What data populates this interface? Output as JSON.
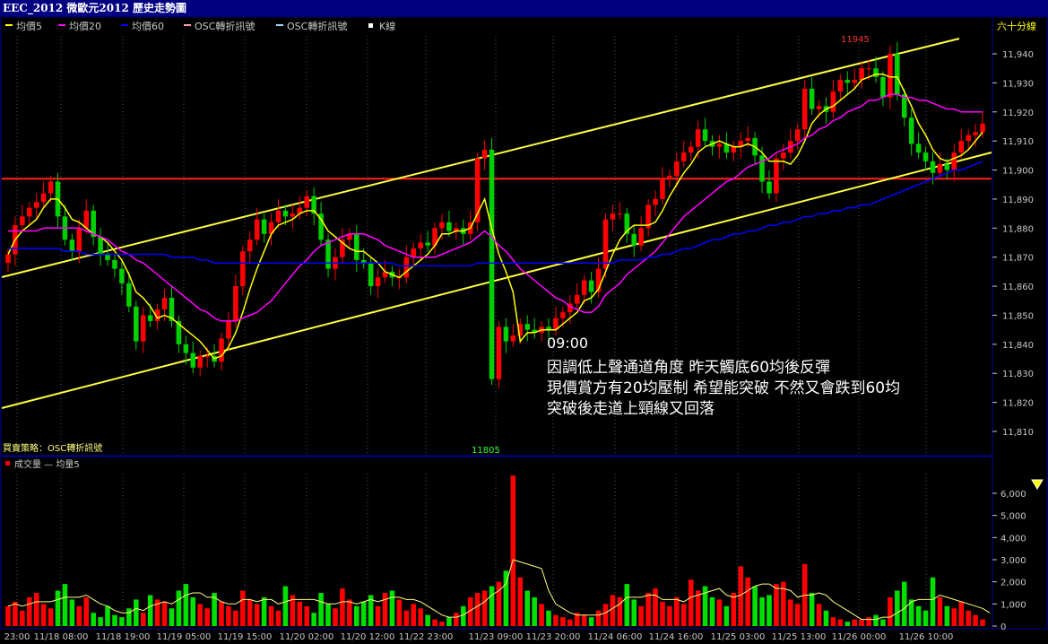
{
  "window": {
    "title": "EEC_2012 微歐元2012  歷史走勢圖"
  },
  "legend": [
    {
      "label": "均價5",
      "color": "#ffff00"
    },
    {
      "label": "均價20",
      "color": "#ff00ff"
    },
    {
      "label": "均價60",
      "color": "#0000ff"
    },
    {
      "label": "OSC轉折訊號",
      "color": "#ff9fc0"
    },
    {
      "label": "OSC轉折訊號",
      "color": "#9fd8ff"
    },
    {
      "label": "K線",
      "color": "#ffffff"
    }
  ],
  "period_label": "六十分線",
  "strategy_label": "買賣策略：OSC轉折訊號",
  "volume_legend": "成交量 — 均量5",
  "annotation": {
    "time": "09:00",
    "lines": [
      "因調低上聲通道角度 昨天觸底60均後反彈",
      "現價賞方有20均壓制 希望能突破 不然又會跌到60均",
      "突破後走道上頸線又回落"
    ]
  },
  "chart_data": [
    {
      "type": "candlestick",
      "title": "EEC_2012 微歐元2012 歷史走勢圖",
      "period": "六十分線",
      "y_range": [
        11805,
        11948
      ],
      "y_ticks": [
        "11,940",
        "11,930",
        "11,920",
        "11,910",
        "11,900",
        "11,890",
        "11,880",
        "11,870",
        "11,860",
        "11,850",
        "11,840",
        "11,830",
        "11,820",
        "11,810"
      ],
      "x_ticks": [
        "23:00",
        "11/18 08:00",
        "11/18 19:00",
        "11/19 05:00",
        "11/19 15:00",
        "11/20 02:00",
        "11/20 12:00",
        "11/22 23:00",
        "11/23 09:00",
        "11/23 20:00",
        "11/24 06:00",
        "11/24 16:00",
        "11/25 03:00",
        "11/25 13:00",
        "11/26 00:00",
        "11/26 10:00"
      ],
      "high_label": "11945",
      "low_label": "11805",
      "series": [
        {
          "name": "K線",
          "color": "#ffffff",
          "close": [
            11871,
            11881,
            11884,
            11887,
            11889,
            11892,
            11896,
            11884,
            11876,
            11872,
            11880,
            11886,
            11877,
            11871,
            11869,
            11866,
            11861,
            11853,
            11841,
            11850,
            11848,
            11852,
            11856,
            11848,
            11840,
            11837,
            11832,
            11836,
            11836,
            11834,
            11842,
            11848,
            11860,
            11872,
            11876,
            11883,
            11878,
            11882,
            11886,
            11884,
            11885,
            11887,
            11891,
            11885,
            11876,
            11866,
            11870,
            11876,
            11878,
            11869,
            11868,
            11860,
            11863,
            11865,
            11863,
            11863,
            11870,
            11873,
            11875,
            11874,
            11880,
            11882,
            11879,
            11880,
            11878,
            11882,
            11904,
            11907,
            11828,
            11846,
            11841,
            11843,
            11847,
            11845,
            11844,
            11846,
            11845,
            11849,
            11851,
            11854,
            11857,
            11862,
            11858,
            11866,
            11883,
            11885,
            11885,
            11878,
            11874,
            11880,
            11888,
            11890,
            11897,
            11898,
            11903,
            11906,
            11908,
            11914,
            11910,
            11908,
            11909,
            11906,
            11908,
            11910,
            11911,
            11905,
            11896,
            11892,
            11904,
            11906,
            11910,
            11914,
            11928,
            11921,
            11922,
            11920,
            11927,
            11931,
            11930,
            11931,
            11935,
            11935,
            11932,
            11925,
            11940,
            11926,
            11918,
            11909,
            11906,
            11903,
            11899,
            11902,
            11900,
            11906,
            11910,
            11912,
            11913,
            11916
          ]
        },
        {
          "name": "均價5",
          "color": "#ffff00",
          "values": [
            11871,
            11876,
            11879,
            11881,
            11883,
            11887,
            11890,
            11890,
            11887,
            11883,
            11882,
            11880,
            11878,
            11877,
            11875,
            11872,
            11869,
            11864,
            11858,
            11856,
            11853,
            11849,
            11850,
            11849,
            11847,
            11845,
            11843,
            11841,
            11838,
            11835,
            11836,
            11839,
            11844,
            11851,
            11859,
            11866,
            11872,
            11878,
            11881,
            11882,
            11883,
            11885,
            11886,
            11886,
            11883,
            11879,
            11877,
            11875,
            11873,
            11872,
            11872,
            11870,
            11868,
            11865,
            11864,
            11863,
            11865,
            11867,
            11869,
            11871,
            11874,
            11878,
            11878,
            11879,
            11879,
            11880,
            11885,
            11890,
            11880,
            11871,
            11865,
            11858,
            11841,
            11844,
            11844,
            11845,
            11845,
            11845,
            11847,
            11849,
            11851,
            11855,
            11856,
            11859,
            11865,
            11871,
            11876,
            11879,
            11881,
            11881,
            11881,
            11882,
            11886,
            11891,
            11895,
            11899,
            11902,
            11906,
            11908,
            11909,
            11910,
            11909,
            11908,
            11908,
            11909,
            11908,
            11906,
            11903,
            11903,
            11903,
            11902,
            11905,
            11910,
            11916,
            11919,
            11921,
            11922,
            11924,
            11926,
            11928,
            11931,
            11932,
            11933,
            11933,
            11932,
            11932,
            11927,
            11922,
            11916,
            11912,
            11907,
            11904,
            11903,
            11904,
            11905,
            11907,
            11910,
            11913
          ]
        },
        {
          "name": "均價20",
          "color": "#ff00ff",
          "values": [
            11879,
            11879,
            11879,
            11879,
            11879,
            11880,
            11880,
            11880,
            11880,
            11880,
            11880,
            11879,
            11878,
            11877,
            11876,
            11874,
            11872,
            11871,
            11869,
            11868,
            11866,
            11864,
            11862,
            11860,
            11858,
            11856,
            11854,
            11852,
            11851,
            11849,
            11848,
            11848,
            11848,
            11849,
            11850,
            11851,
            11853,
            11855,
            11858,
            11861,
            11864,
            11867,
            11869,
            11872,
            11874,
            11875,
            11876,
            11877,
            11878,
            11878,
            11878,
            11877,
            11876,
            11874,
            11873,
            11872,
            11871,
            11870,
            11870,
            11870,
            11870,
            11871,
            11872,
            11873,
            11874,
            11875,
            11877,
            11879,
            11877,
            11874,
            11872,
            11869,
            11866,
            11864,
            11862,
            11860,
            11858,
            11856,
            11855,
            11853,
            11852,
            11851,
            11851,
            11853,
            11857,
            11859,
            11861,
            11864,
            11866,
            11868,
            11870,
            11872,
            11875,
            11878,
            11881,
            11884,
            11886,
            11888,
            11890,
            11892,
            11894,
            11896,
            11897,
            11899,
            11901,
            11902,
            11903,
            11904,
            11906,
            11907,
            11908,
            11909,
            11911,
            11912,
            11914,
            11915,
            11917,
            11918,
            11920,
            11921,
            11922,
            11924,
            11924,
            11925,
            11926,
            11926,
            11925,
            11925,
            11924,
            11924,
            11923,
            11922,
            11921,
            11921,
            11920,
            11920,
            11920,
            11920
          ]
        },
        {
          "name": "均價60",
          "color": "#0000ff",
          "values": [
            11873,
            11873,
            11873,
            11873,
            11873,
            11873,
            11873,
            11873,
            11872,
            11872,
            11872,
            11871,
            11871,
            11871,
            11871,
            11871,
            11871,
            11871,
            11871,
            11871,
            11871,
            11871,
            11871,
            11870,
            11870,
            11870,
            11870,
            11869,
            11869,
            11868,
            11868,
            11868,
            11868,
            11868,
            11868,
            11868,
            11868,
            11868,
            11868,
            11868,
            11868,
            11868,
            11868,
            11868,
            11868,
            11868,
            11868,
            11868,
            11868,
            11868,
            11868,
            11868,
            11868,
            11868,
            11868,
            11867,
            11867,
            11867,
            11867,
            11867,
            11867,
            11867,
            11867,
            11867,
            11867,
            11867,
            11868,
            11868,
            11868,
            11868,
            11868,
            11868,
            11868,
            11868,
            11868,
            11868,
            11868,
            11868,
            11868,
            11868,
            11868,
            11868,
            11868,
            11868,
            11868,
            11868,
            11869,
            11869,
            11869,
            11869,
            11870,
            11870,
            11871,
            11871,
            11872,
            11873,
            11873,
            11874,
            11875,
            11876,
            11876,
            11877,
            11878,
            11878,
            11879,
            11879,
            11880,
            11881,
            11881,
            11882,
            11882,
            11883,
            11884,
            11884,
            11885,
            11885,
            11886,
            11886,
            11887,
            11887,
            11888,
            11888,
            11889,
            11890,
            11891,
            11892,
            11893,
            11894,
            11895,
            11896,
            11897,
            11898,
            11899,
            11900,
            11900,
            11901,
            11902,
            11903
          ]
        }
      ],
      "horizontal_line": 11897,
      "channel_lines": 3
    },
    {
      "type": "bar",
      "title": "成交量 — 均量5",
      "y_range": [
        0,
        7000
      ],
      "y_ticks": [
        "6,000",
        "5,000",
        "4,000",
        "3,000",
        "2,000",
        "1,000",
        "0"
      ],
      "series": [
        {
          "name": "成交量",
          "values": [
            900,
            1100,
            700,
            1300,
            1500,
            1000,
            800,
            1600,
            1900,
            1200,
            900,
            1300,
            600,
            400,
            900,
            500,
            400,
            800,
            1200,
            600,
            1400,
            1200,
            1100,
            800,
            1600,
            1900,
            1300,
            1000,
            800,
            1500,
            1100,
            900,
            700,
            1600,
            1200,
            1000,
            1300,
            900,
            700,
            1800,
            1400,
            1100,
            900,
            600,
            1500,
            1000,
            800,
            1700,
            1200,
            900,
            1100,
            1400,
            900,
            1500,
            1600,
            1200,
            700,
            1000,
            800,
            500,
            300,
            200,
            400,
            600,
            900,
            1300,
            1500,
            1600,
            1800,
            2000,
            2500,
            6800,
            2200,
            1600,
            1300,
            1000,
            700,
            500,
            400,
            300,
            600,
            500,
            400,
            700,
            1000,
            1400,
            1300,
            1900,
            1200,
            900,
            1500,
            1700,
            1100,
            900,
            1300,
            1000,
            2100,
            1600,
            1800,
            1300,
            1200,
            900,
            1500,
            2700,
            2200,
            1800,
            1300,
            1400,
            1900,
            2000,
            1200,
            1000,
            2800,
            1500,
            1000,
            700,
            400,
            300,
            200,
            300,
            300,
            400,
            500,
            300,
            1300,
            1600,
            2000,
            1200,
            900,
            700,
            2200,
            1300,
            900,
            800,
            1100,
            700,
            500,
            300
          ]
        },
        {
          "name": "均量5",
          "color": "#ffff80",
          "values": [
            900,
            1000,
            900,
            1000,
            1100,
            1100,
            1100,
            1200,
            1300,
            1300,
            1300,
            1400,
            1200,
            1000,
            900,
            700,
            600,
            600,
            800,
            700,
            900,
            1000,
            1100,
            1000,
            1200,
            1400,
            1500,
            1500,
            1300,
            1300,
            1100,
            1000,
            1000,
            1200,
            1200,
            1100,
            1200,
            1200,
            1000,
            1100,
            1200,
            1200,
            1200,
            1200,
            1100,
            1000,
            1000,
            1100,
            1100,
            1000,
            1100,
            1200,
            1100,
            1200,
            1300,
            1300,
            1200,
            1200,
            1100,
            900,
            700,
            500,
            400,
            400,
            500,
            700,
            900,
            1100,
            1400,
            1600,
            1900,
            3000,
            2900,
            2800,
            2700,
            2600,
            1600,
            1000,
            800,
            600,
            500,
            500,
            500,
            500,
            600,
            800,
            1000,
            1300,
            1300,
            1300,
            1400,
            1400,
            1200,
            1200,
            1200,
            1100,
            1300,
            1400,
            1500,
            1600,
            1700,
            1400,
            1300,
            1400,
            1600,
            1800,
            1900,
            1900,
            1700,
            1700,
            1600,
            1300,
            1400,
            1400,
            1500,
            1400,
            1100,
            900,
            700,
            500,
            300,
            300,
            300,
            400,
            400,
            600,
            800,
            1100,
            1200,
            1200,
            1200,
            1400,
            1300,
            1200,
            1100,
            1000,
            900,
            800,
            600
          ]
        }
      ]
    }
  ]
}
